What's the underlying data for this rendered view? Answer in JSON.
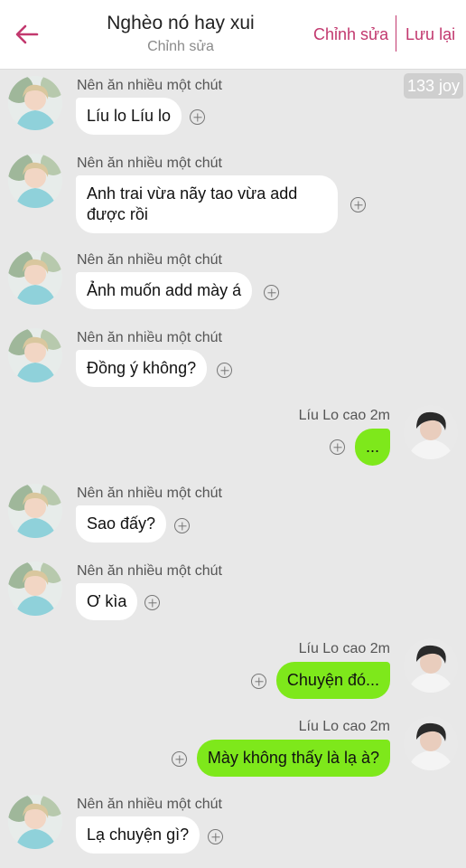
{
  "header": {
    "title": "Nghèo nó hay xui",
    "subtitle": "Chỉnh sửa",
    "edit_label": "Chỉnh sửa",
    "save_label": "Lưu lại",
    "accent_color": "#c2386e"
  },
  "joy_badge": "133 joy",
  "colors": {
    "incoming_bubble": "#ffffff",
    "outgoing_bubble": "#7ee81b",
    "background": "#e8e8e8"
  },
  "messages": [
    {
      "sender": "Nên ăn nhiều một chút",
      "text": "Líu lo Líu lo",
      "direction": "incoming"
    },
    {
      "sender": "Nên ăn nhiều một chút",
      "text": "Anh trai vừa nãy tao vừa add được rồi",
      "direction": "incoming"
    },
    {
      "sender": "Nên ăn nhiều một chút",
      "text": "Ảnh muốn add mày á",
      "direction": "incoming"
    },
    {
      "sender": "Nên ăn nhiều một chút",
      "text": "Đồng ý không?",
      "direction": "incoming"
    },
    {
      "sender": "Líu Lo cao 2m",
      "text": "...",
      "direction": "outgoing"
    },
    {
      "sender": "Nên ăn nhiều một chút",
      "text": "Sao đấy?",
      "direction": "incoming"
    },
    {
      "sender": "Nên ăn nhiều một chút",
      "text": "Ơ kìa",
      "direction": "incoming"
    },
    {
      "sender": "Líu Lo cao 2m",
      "text": "Chuyện đó...",
      "direction": "outgoing"
    },
    {
      "sender": "Líu Lo cao 2m",
      "text": "Mày không thấy là lạ à?",
      "direction": "outgoing"
    },
    {
      "sender": "Nên ăn nhiều một chút",
      "text": "Lạ chuyện gì?",
      "direction": "incoming"
    }
  ]
}
